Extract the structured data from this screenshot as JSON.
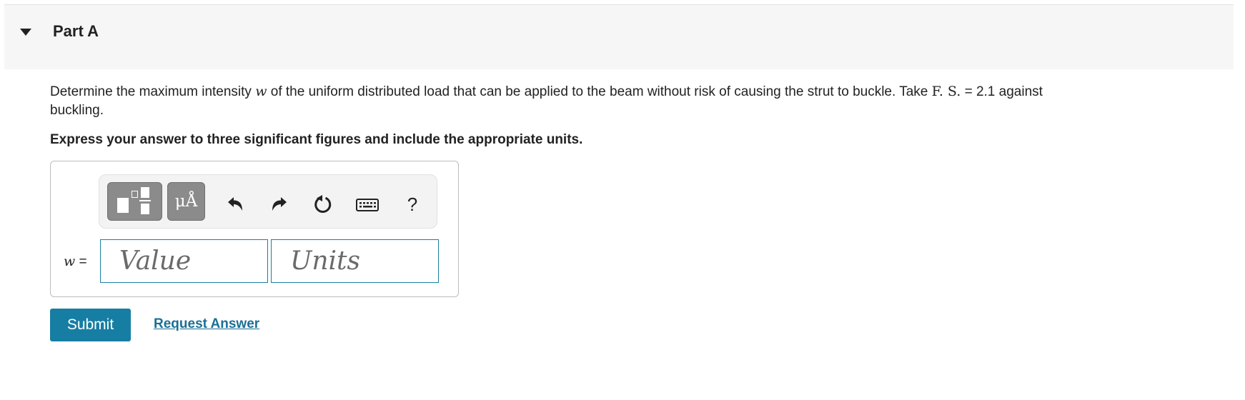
{
  "part": {
    "title": "Part A"
  },
  "question": {
    "text_before": "Determine the maximum intensity ",
    "variable": "w",
    "text_middle": " of the uniform distributed load that can be applied to the beam without risk of causing the strut to buckle. Take ",
    "fs_label": "F. S.",
    "text_after": " = 2.1 against buckling."
  },
  "instructions": "Express your answer to three significant figures and include the appropriate units.",
  "toolbar": {
    "templates_icon": "templates-icon",
    "units_label": "μÅ",
    "undo_icon": "undo-icon",
    "redo_icon": "redo-icon",
    "reset_icon": "reset-icon",
    "keyboard_icon": "keyboard-icon",
    "help_label": "?"
  },
  "answer": {
    "variable": "w",
    "equals": "=",
    "value_placeholder": "Value",
    "units_placeholder": "Units"
  },
  "actions": {
    "submit_label": "Submit",
    "request_label": "Request Answer"
  },
  "colors": {
    "accent": "#177ea3",
    "link": "#1a6f95",
    "toolbar_button": "#8b8b8b",
    "header_bg": "#f6f6f6"
  }
}
